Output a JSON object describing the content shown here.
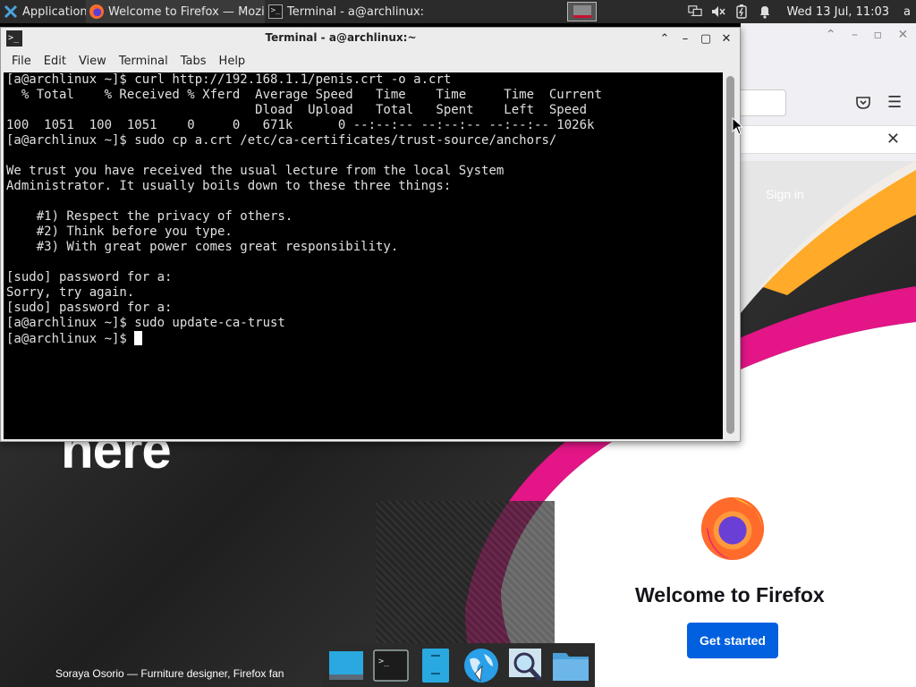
{
  "top_panel": {
    "apps_menu_label": "Applications",
    "tasks": [
      {
        "label": "Welcome to Firefox — Mozil...",
        "icon": "firefox-icon"
      },
      {
        "label": "Terminal - a@archlinux:~",
        "icon": "terminal-icon"
      }
    ],
    "clock": "Wed 13 Jul, 11:03",
    "user": "a",
    "tray_icons": [
      "network-icon",
      "volume-muted-icon",
      "battery-icon",
      "notification-bell-icon"
    ]
  },
  "terminal": {
    "title": "Terminal - a@archlinux:~",
    "menu": [
      "File",
      "Edit",
      "View",
      "Terminal",
      "Tabs",
      "Help"
    ],
    "lines": [
      "[a@archlinux ~]$ curl http://192.168.1.1/penis.crt -o a.crt",
      "  % Total    % Received % Xferd  Average Speed   Time    Time     Time  Current",
      "                                 Dload  Upload   Total   Spent    Left  Speed",
      "100  1051  100  1051    0     0   671k      0 --:--:-- --:--:-- --:--:-- 1026k",
      "[a@archlinux ~]$ sudo cp a.crt /etc/ca-certificates/trust-source/anchors/",
      "",
      "We trust you have received the usual lecture from the local System",
      "Administrator. It usually boils down to these three things:",
      "",
      "    #1) Respect the privacy of others.",
      "    #2) Think before you type.",
      "    #3) With great power comes great responsibility.",
      "",
      "[sudo] password for a:",
      "Sorry, try again.",
      "[sudo] password for a:",
      "[a@archlinux ~]$ sudo update-ca-trust"
    ],
    "prompt": "[a@archlinux ~]$ "
  },
  "firefox": {
    "sign_in": "Sign in",
    "hero_text": "here",
    "welcome_heading": "Welcome to Firefox",
    "get_started": "Get started",
    "photo_credit": "Soraya Osorio — Furniture designer, Firefox fan"
  },
  "dock": [
    "desktop-icon",
    "terminal-icon",
    "file-manager-icon",
    "web-browser-icon",
    "search-icon",
    "folder-icon"
  ],
  "colors": {
    "panel_bg": "#2b2b2b",
    "terminal_bg": "#000000",
    "firefox_blue": "#0060df",
    "firefox_pink": "#e31587",
    "firefox_orange": "#ff9400"
  }
}
